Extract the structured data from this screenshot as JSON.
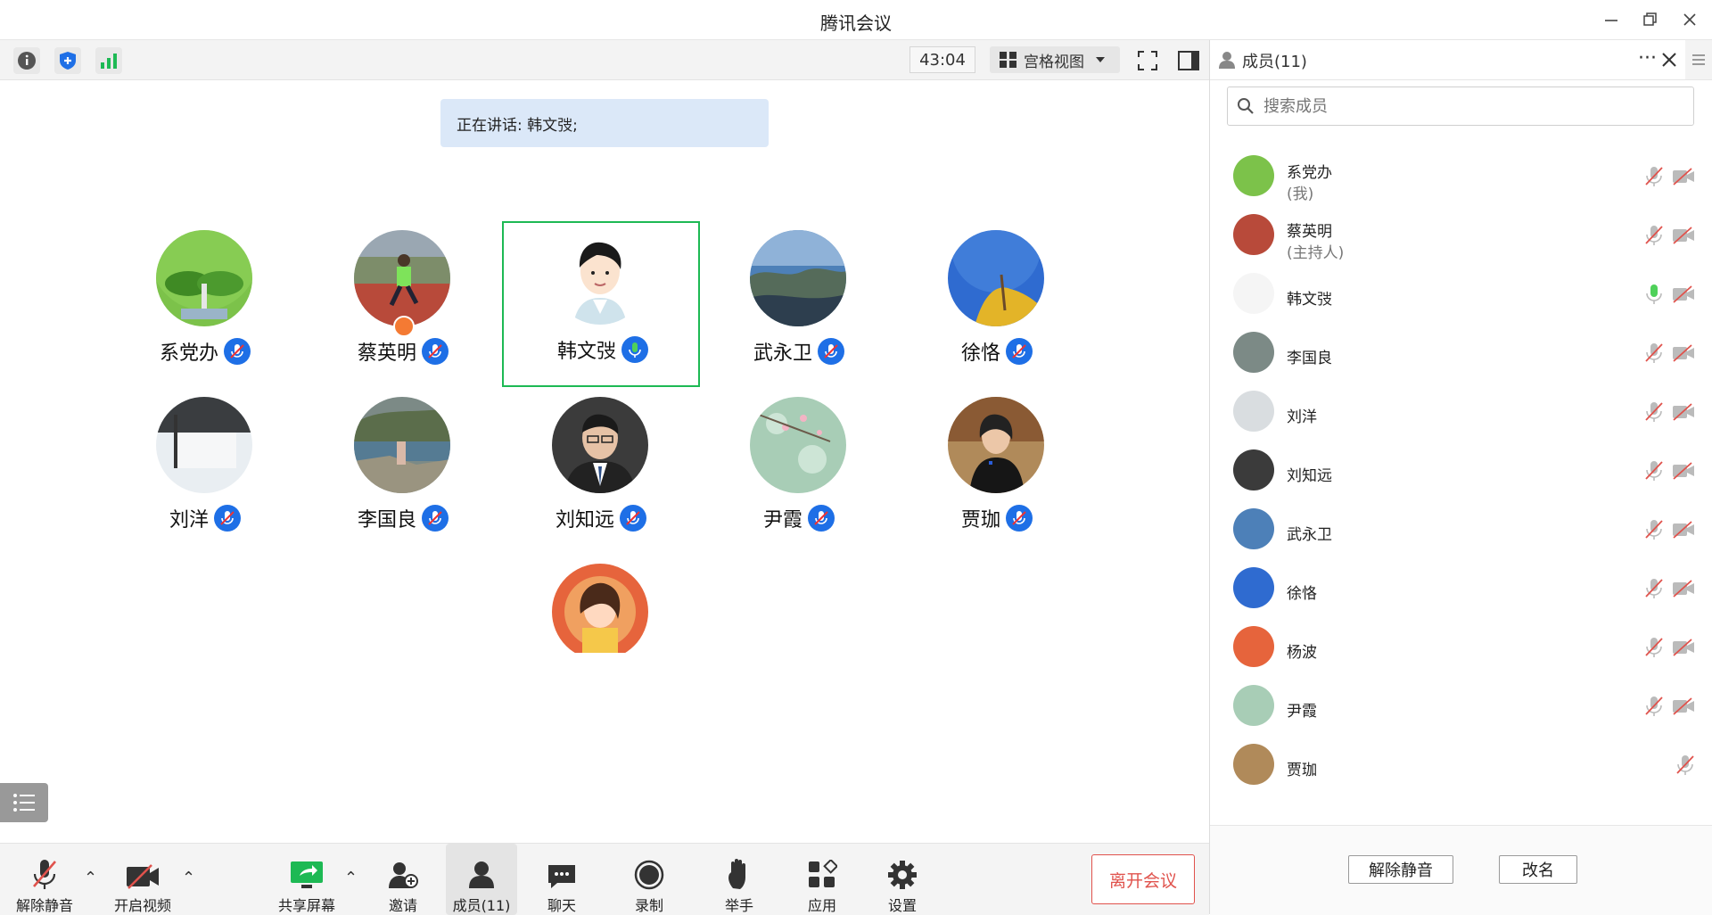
{
  "app_title": "腾讯会议",
  "toolbar": {
    "timer": "43:04",
    "view_label": "宫格视图"
  },
  "speaking_banner": "正在讲话: 韩文弢;",
  "tiles": [
    {
      "name": "系党办",
      "speaking": false
    },
    {
      "name": "蔡英明",
      "speaking": false,
      "host": true
    },
    {
      "name": "韩文弢",
      "speaking": true
    },
    {
      "name": "武永卫",
      "speaking": false
    },
    {
      "name": "徐恪",
      "speaking": false
    },
    {
      "name": "刘洋",
      "speaking": false
    },
    {
      "name": "李国良",
      "speaking": false
    },
    {
      "name": "刘知远",
      "speaking": false
    },
    {
      "name": "尹霞",
      "speaking": false
    },
    {
      "name": "贾珈",
      "speaking": false
    },
    {
      "name": "",
      "speaking": false
    }
  ],
  "bottombar": {
    "unmute": "解除静音",
    "video": "开启视频",
    "share": "共享屏幕",
    "invite": "邀请",
    "members": "成员(11)",
    "chat": "聊天",
    "record": "录制",
    "raise_hand": "举手",
    "apps": "应用",
    "settings": "设置",
    "leave": "离开会议"
  },
  "panel": {
    "title": "成员(11)",
    "search_placeholder": "搜索成员",
    "members": [
      {
        "name": "系党办",
        "sub": "(我)",
        "mic": "muted",
        "cam": "off"
      },
      {
        "name": "蔡英明",
        "sub": "(主持人)",
        "mic": "muted",
        "cam": "off"
      },
      {
        "name": "韩文弢",
        "sub": "",
        "mic": "speaking",
        "cam": "off"
      },
      {
        "name": "李国良",
        "sub": "",
        "mic": "muted",
        "cam": "off"
      },
      {
        "name": "刘洋",
        "sub": "",
        "mic": "muted",
        "cam": "off"
      },
      {
        "name": "刘知远",
        "sub": "",
        "mic": "muted",
        "cam": "off"
      },
      {
        "name": "武永卫",
        "sub": "",
        "mic": "muted",
        "cam": "off"
      },
      {
        "name": "徐恪",
        "sub": "",
        "mic": "muted",
        "cam": "off"
      },
      {
        "name": "杨波",
        "sub": "",
        "mic": "muted",
        "cam": "off"
      },
      {
        "name": "尹霞",
        "sub": "",
        "mic": "muted",
        "cam": "off"
      },
      {
        "name": "贾珈",
        "sub": "",
        "mic": "muted",
        "cam": "none"
      }
    ],
    "unmute_all": "解除静音",
    "rename": "改名"
  },
  "colors": {
    "accent": "#1e6fe6",
    "speaking": "#1db954",
    "leave": "#e0524c",
    "banner": "#dbe8f8"
  }
}
